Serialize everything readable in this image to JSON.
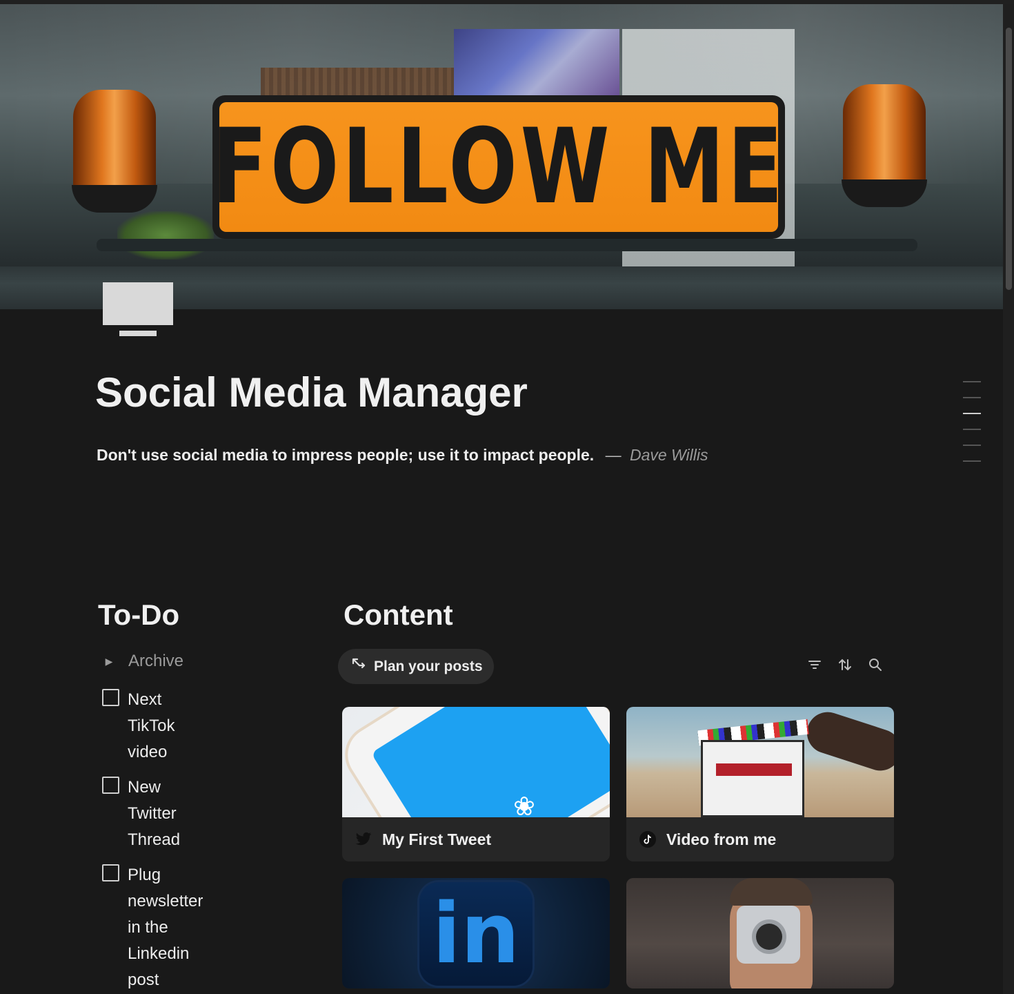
{
  "cover": {
    "sign_text": "FOLLOW ME"
  },
  "page": {
    "icon": "monitor-icon",
    "title": "Social Media Manager",
    "quote": {
      "text": "Don't use social media to impress people; use it to impact people.",
      "dash": "—",
      "author": "Dave Willis"
    }
  },
  "toc": {
    "line_count": 6,
    "active_index": 2
  },
  "todo": {
    "heading": "To-Do",
    "archive_label": "Archive",
    "items": [
      {
        "label": "Next TikTok video",
        "checked": false
      },
      {
        "label": "New Twitter Thread",
        "checked": false
      },
      {
        "label": "Plug newsletter  in the Linkedin post",
        "checked": false
      }
    ]
  },
  "content": {
    "heading": "Content",
    "plan_button_label": "Plan your posts",
    "tools": [
      "filter-icon",
      "sort-icon",
      "search-icon"
    ],
    "cards": [
      {
        "title": "My First Tweet",
        "icon": "twitter-icon"
      },
      {
        "title": "Video from me",
        "icon": "tiktok-icon"
      },
      {
        "title": "",
        "icon": "linkedin-icon"
      },
      {
        "title": "",
        "icon": "camera-icon"
      }
    ]
  },
  "colors": {
    "background": "#191919",
    "sign_orange": "#f7941d",
    "twitter_blue": "#1da1f2",
    "linkedin_blue": "#2a8fe8"
  }
}
